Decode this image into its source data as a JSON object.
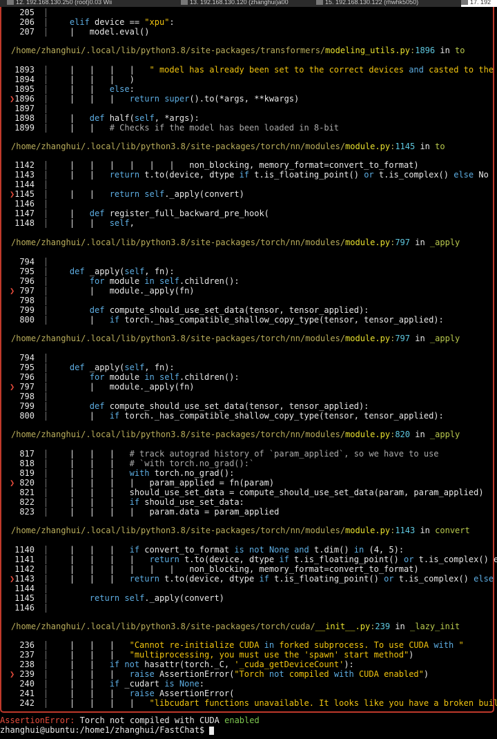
{
  "tabs": [
    {
      "label": "12. 192.168.130.250 (root)0.03 Wii"
    },
    {
      "label": "13. 192.168.130.120 (zhanghui)a00"
    },
    {
      "label": "15. 192.168.130.122 (rhwhk5050)"
    },
    {
      "label": "17. 192"
    }
  ],
  "blocks": [
    {
      "header": null,
      "lines": [
        {
          "n": "205",
          "current": false,
          "code": ""
        },
        {
          "n": "206",
          "current": false,
          "code": "    elif device == \"xpu\":"
        },
        {
          "n": "207",
          "current": false,
          "code": "    |   model.eval()"
        }
      ]
    },
    {
      "header": {
        "path": "/home/zhanghui/.local/lib/python3.8/site-packages/transformers/",
        "file": "modeling_utils.py",
        "lineno": "1896",
        "in": " in ",
        "func": "to"
      },
      "lines": [
        {
          "n": "1893",
          "current": false,
          "code": "    |   |   |   |   \" model has already been set to the correct devices and casted to the co"
        },
        {
          "n": "1894",
          "current": false,
          "code": "    |   |   |   )"
        },
        {
          "n": "1895",
          "current": false,
          "code": "    |   |   else:"
        },
        {
          "n": "1896",
          "current": true,
          "code": "    |   |   |   return super().to(*args, **kwargs)"
        },
        {
          "n": "1897",
          "current": false,
          "code": ""
        },
        {
          "n": "1898",
          "current": false,
          "code": "    |   def half(self, *args):"
        },
        {
          "n": "1899",
          "current": false,
          "code": "    |   |   # Checks if the model has been loaded in 8-bit"
        }
      ]
    },
    {
      "header": {
        "path": "/home/zhanghui/.local/lib/python3.8/site-packages/torch/nn/modules/",
        "file": "module.py",
        "lineno": "1145",
        "in": " in ",
        "func": "to"
      },
      "lines": [
        {
          "n": "1142",
          "current": false,
          "code": "    |   |   |   |   |   |   non_blocking, memory_format=convert_to_format)"
        },
        {
          "n": "1143",
          "current": false,
          "code": "    |   |   return t.to(device, dtype if t.is_floating_point() or t.is_complex() else No"
        },
        {
          "n": "1144",
          "current": false,
          "code": ""
        },
        {
          "n": "1145",
          "current": true,
          "code": "    |   |   return self._apply(convert)"
        },
        {
          "n": "1146",
          "current": false,
          "code": ""
        },
        {
          "n": "1147",
          "current": false,
          "code": "    |   def register_full_backward_pre_hook("
        },
        {
          "n": "1148",
          "current": false,
          "code": "    |   |   self,"
        }
      ]
    },
    {
      "header": {
        "path": "/home/zhanghui/.local/lib/python3.8/site-packages/torch/nn/modules/",
        "file": "module.py",
        "lineno": "797",
        "in": " in ",
        "func": "_apply"
      },
      "lines": [
        {
          "n": "794",
          "current": false,
          "code": ""
        },
        {
          "n": "795",
          "current": false,
          "code": "    def _apply(self, fn):"
        },
        {
          "n": "796",
          "current": false,
          "code": "        for module in self.children():"
        },
        {
          "n": "797",
          "current": true,
          "code": "        |   module._apply(fn)"
        },
        {
          "n": "798",
          "current": false,
          "code": ""
        },
        {
          "n": "799",
          "current": false,
          "code": "        def compute_should_use_set_data(tensor, tensor_applied):"
        },
        {
          "n": "800",
          "current": false,
          "code": "        |   if torch._has_compatible_shallow_copy_type(tensor, tensor_applied):"
        }
      ]
    },
    {
      "header": {
        "path": "/home/zhanghui/.local/lib/python3.8/site-packages/torch/nn/modules/",
        "file": "module.py",
        "lineno": "797",
        "in": " in ",
        "func": "_apply"
      },
      "lines": [
        {
          "n": "794",
          "current": false,
          "code": ""
        },
        {
          "n": "795",
          "current": false,
          "code": "    def _apply(self, fn):"
        },
        {
          "n": "796",
          "current": false,
          "code": "        for module in self.children():"
        },
        {
          "n": "797",
          "current": true,
          "code": "        |   module._apply(fn)"
        },
        {
          "n": "798",
          "current": false,
          "code": ""
        },
        {
          "n": "799",
          "current": false,
          "code": "        def compute_should_use_set_data(tensor, tensor_applied):"
        },
        {
          "n": "800",
          "current": false,
          "code": "        |   if torch._has_compatible_shallow_copy_type(tensor, tensor_applied):"
        }
      ]
    },
    {
      "header": {
        "path": "/home/zhanghui/.local/lib/python3.8/site-packages/torch/nn/modules/",
        "file": "module.py",
        "lineno": "820",
        "in": " in ",
        "func": "_apply"
      },
      "lines": [
        {
          "n": "817",
          "current": false,
          "code": "    |   |   |   # track autograd history of `param_applied`, so we have to use"
        },
        {
          "n": "818",
          "current": false,
          "code": "    |   |   |   # `with torch.no_grad():`"
        },
        {
          "n": "819",
          "current": false,
          "code": "    |   |   |   with torch.no_grad():"
        },
        {
          "n": "820",
          "current": true,
          "code": "    |   |   |   |   param_applied = fn(param)"
        },
        {
          "n": "821",
          "current": false,
          "code": "    |   |   |   should_use_set_data = compute_should_use_set_data(param, param_applied)"
        },
        {
          "n": "822",
          "current": false,
          "code": "    |   |   |   if should_use_set_data:"
        },
        {
          "n": "823",
          "current": false,
          "code": "    |   |   |   |   param.data = param_applied"
        }
      ]
    },
    {
      "header": {
        "path": "/home/zhanghui/.local/lib/python3.8/site-packages/torch/nn/modules/",
        "file": "module.py",
        "lineno": "1143",
        "in": " in ",
        "func": "convert"
      },
      "lines": [
        {
          "n": "1140",
          "current": false,
          "code": "    |   |   |   if convert_to_format is not None and t.dim() in (4, 5):"
        },
        {
          "n": "1141",
          "current": false,
          "code": "    |   |   |   |   return t.to(device, dtype if t.is_floating_point() or t.is_complex() els"
        },
        {
          "n": "1142",
          "current": false,
          "code": "    |   |   |   |   |   |   non_blocking, memory_format=convert_to_format)"
        },
        {
          "n": "1143",
          "current": true,
          "code": "    |   |   |   return t.to(device, dtype if t.is_floating_point() or t.is_complex() else No"
        },
        {
          "n": "1144",
          "current": false,
          "code": ""
        },
        {
          "n": "1145",
          "current": false,
          "code": "        return self._apply(convert)"
        },
        {
          "n": "1146",
          "current": false,
          "code": ""
        }
      ]
    },
    {
      "header": {
        "path": "/home/zhanghui/.local/lib/python3.8/site-packages/torch/cuda/",
        "file": "__init__.py",
        "lineno": "239",
        "in": " in ",
        "func": "_lazy_init"
      },
      "lines": [
        {
          "n": "236",
          "current": false,
          "code": "    |   |   |   \"Cannot re-initialize CUDA in forked subprocess. To use CUDA with \""
        },
        {
          "n": "237",
          "current": false,
          "code": "    |   |   |   \"multiprocessing, you must use the 'spawn' start method\")"
        },
        {
          "n": "238",
          "current": false,
          "code": "    |   |   if not hasattr(torch._C, '_cuda_getDeviceCount'):"
        },
        {
          "n": "239",
          "current": true,
          "code": "    |   |   |   raise AssertionError(\"Torch not compiled with CUDA enabled\")"
        },
        {
          "n": "240",
          "current": false,
          "code": "    |   |   if _cudart is None:"
        },
        {
          "n": "241",
          "current": false,
          "code": "    |   |   |   raise AssertionError("
        },
        {
          "n": "242",
          "current": false,
          "code": "    |   |   |   |   \"libcudart functions unavailable. It looks like you have a broken build?"
        }
      ]
    }
  ],
  "error": {
    "name": "AssertionError:",
    "message": " Torch not compiled with CUDA ",
    "tail": "enabled"
  },
  "prompt": {
    "text": "zhanghui@ubuntu:/home1/zhanghui/FastChat$ "
  },
  "current_marker": "❯"
}
